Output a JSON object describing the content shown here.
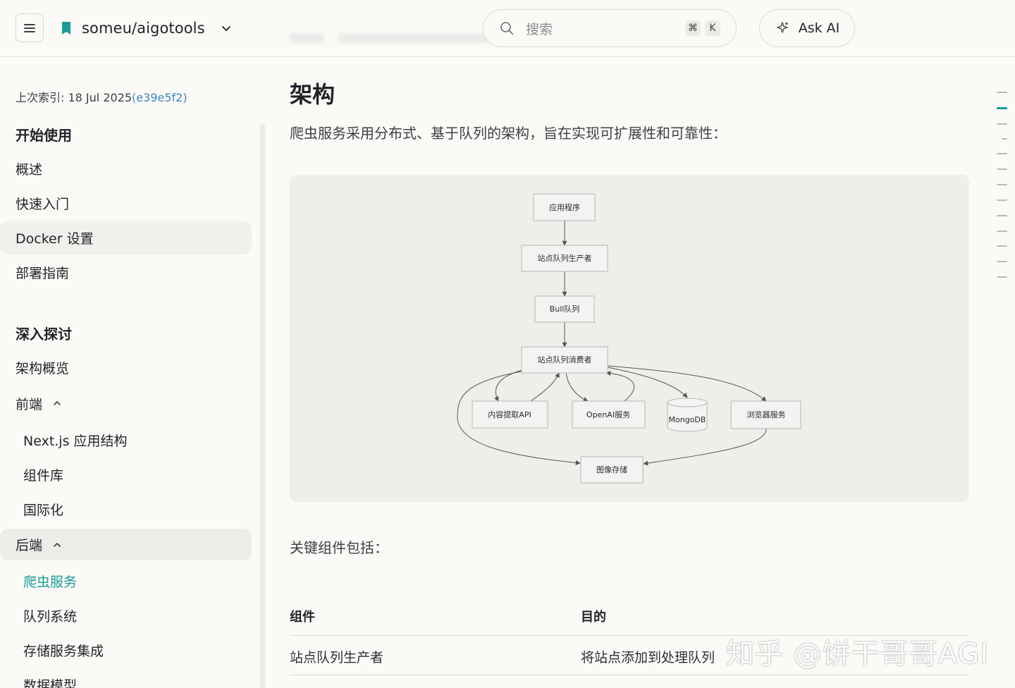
{
  "header": {
    "repo_name": "someu/aigotools",
    "search_placeholder": "搜索",
    "shortcut_cmd": "⌘",
    "shortcut_key": "K",
    "ask_ai_label": "Ask AI",
    "accent_color": "#1b9a98"
  },
  "sidebar": {
    "indexed_label": "上次索引: 18 Jul 2025",
    "commit": "(e39e5f2)",
    "section_getting_started": "开始使用",
    "items_getting_started": [
      "概述",
      "快速入门",
      "Docker 设置",
      "部署指南"
    ],
    "section_deep_dive": "深入探讨",
    "architecture_overview": "架构概览",
    "frontend": "前端",
    "frontend_items": [
      "Next.js 应用结构",
      "组件库",
      "国际化"
    ],
    "backend": "后端",
    "backend_items": [
      "爬虫服务",
      "队列系统",
      "存储服务集成",
      "数据模型"
    ]
  },
  "main": {
    "title": "架构",
    "lead": "爬虫服务采用分布式、基于队列的架构，旨在实现可扩展性和可靠性：",
    "diagram": {
      "app": "应用程序",
      "producer": "站点队列生产者",
      "bull": "Bull队列",
      "consumer": "站点队列消费者",
      "extract": "内容提取API",
      "openai": "OpenAI服务",
      "mongodb": "MongoDB",
      "browser": "浏览器服务",
      "image": "图像存储"
    },
    "subheading": "关键组件包括：",
    "table": {
      "col_component": "组件",
      "col_purpose": "目的",
      "row1_component": "站点队列生产者",
      "row1_purpose": "将站点添加到处理队列"
    }
  },
  "watermark": "知乎 @饼干哥哥AGI"
}
